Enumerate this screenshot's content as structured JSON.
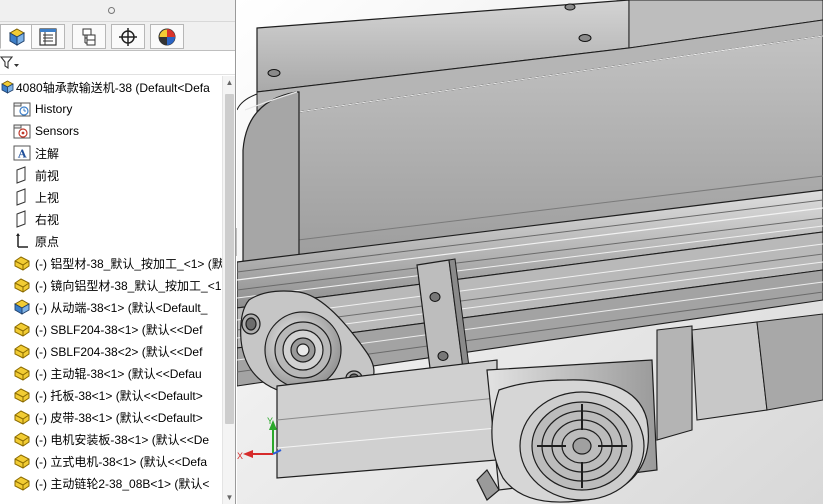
{
  "tree": {
    "root": {
      "label": "4080轴承款输送机-38  (Default<Defa",
      "icon": "assembly-icon"
    },
    "items": [
      {
        "label": "History",
        "icon": "history-folder-icon"
      },
      {
        "label": "Sensors",
        "icon": "sensors-folder-icon"
      },
      {
        "label": "注解",
        "icon": "annotations-icon"
      },
      {
        "label": "前视",
        "icon": "plane-icon"
      },
      {
        "label": "上视",
        "icon": "plane-icon"
      },
      {
        "label": "右视",
        "icon": "plane-icon"
      },
      {
        "label": "原点",
        "icon": "origin-icon"
      },
      {
        "label": "(-) 铝型材-38_默认_按加工_<1> (默",
        "icon": "part-icon"
      },
      {
        "label": "(-) 镜向铝型材-38_默认_按加工_<1",
        "icon": "part-icon"
      },
      {
        "label": "(-) 从动端-38<1> (默认<Default_",
        "icon": "subassembly-icon"
      },
      {
        "label": "(-) SBLF204-38<1> (默认<<Def",
        "icon": "part-icon"
      },
      {
        "label": "(-) SBLF204-38<2> (默认<<Def",
        "icon": "part-icon"
      },
      {
        "label": "(-) 主动辊-38<1> (默认<<Defau",
        "icon": "part-icon"
      },
      {
        "label": "(-) 托板-38<1> (默认<<Default>",
        "icon": "part-icon"
      },
      {
        "label": "(-) 皮带-38<1> (默认<<Default>",
        "icon": "part-icon"
      },
      {
        "label": "(-) 电机安装板-38<1> (默认<<De",
        "icon": "part-icon"
      },
      {
        "label": "(-) 立式电机-38<1> (默认<<Defa",
        "icon": "part-icon"
      },
      {
        "label": "(-) 主动链轮2-38_08B<1> (默认<",
        "icon": "part-icon"
      }
    ]
  },
  "tabs": [
    {
      "name": "feature-manager-tab",
      "icon": "feature-tree-icon"
    },
    {
      "name": "property-manager-tab",
      "icon": "property-icon"
    },
    {
      "name": "configuration-manager-tab",
      "icon": "configuration-icon"
    },
    {
      "name": "dimxpert-tab",
      "icon": "crosshair-icon"
    },
    {
      "name": "display-manager-tab",
      "icon": "color-wheel-icon"
    }
  ],
  "triad": {
    "x_label": "X",
    "y_label": "Y"
  },
  "colors": {
    "part": "#e8c540",
    "part_dark": "#b08a10",
    "assembly": "#3d7fc8",
    "metal_light": "#c9c9c9",
    "metal_mid": "#9c9c9c",
    "metal_dark": "#5c5c5c",
    "edge": "#1e1e1e"
  }
}
